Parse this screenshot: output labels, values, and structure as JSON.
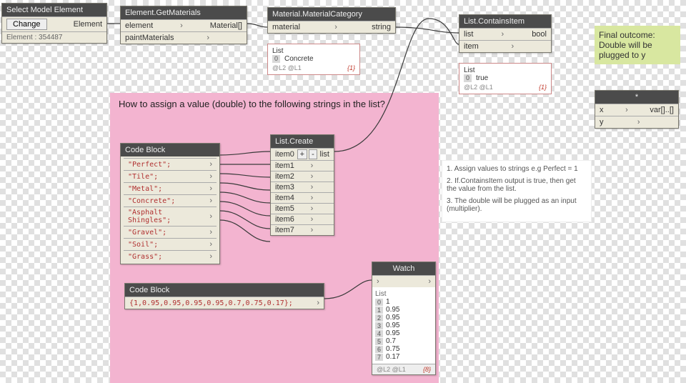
{
  "nodes": {
    "selectModel": {
      "title": "Select Model Element",
      "button": "Change",
      "outPort": "Element",
      "footer": "Element : 354487"
    },
    "getMaterials": {
      "title": "Element.GetMaterials",
      "in1": "element",
      "in2": "paintMaterials",
      "out": "Material[]"
    },
    "matCategory": {
      "title": "Material.MaterialCategory",
      "in": "material",
      "out": "string"
    },
    "containsItem": {
      "title": "List.ContainsItem",
      "in1": "list",
      "in2": "item",
      "out": "bool"
    },
    "multiply": {
      "title": "*",
      "in1": "x",
      "in2": "y",
      "out": "var[]..[]"
    },
    "codeBlock1": {
      "title": "Code Block",
      "lines": [
        "\"Perfect\";",
        "\"Tile\";",
        "\"Metal\";",
        "\"Concrete\";",
        "\"Asphalt Shingles\";",
        "\"Gravel\";",
        "\"Soil\";",
        "\"Grass\";"
      ]
    },
    "listCreate": {
      "title": "List.Create",
      "items": [
        "item0",
        "item1",
        "item2",
        "item3",
        "item4",
        "item5",
        "item6",
        "item7"
      ],
      "out": "list"
    },
    "codeBlock2": {
      "title": "Code Block",
      "code": "{1,0.95,0.95,0.95,0.95,0.7,0.75,0.17};"
    },
    "watch": {
      "title": "Watch",
      "listLabel": "List",
      "values": [
        "1",
        "0.95",
        "0.95",
        "0.95",
        "0.95",
        "0.7",
        "0.75",
        "0.17"
      ],
      "footerL": "@L2 @L1",
      "footerR": "{8}"
    }
  },
  "previews": {
    "matCat": {
      "label": "List",
      "idx": "0",
      "val": "Concrete",
      "footL": "@L2 @L1",
      "footR": "{1}"
    },
    "contains": {
      "label": "List",
      "idx": "0",
      "val": "true",
      "footL": "@L2 @L1",
      "footR": "{1}"
    }
  },
  "annotations": {
    "pinkQuestion": "How to assign a value (double) to the following strings in the list?",
    "greenNote": "Final outcome: Double will be plugged to y",
    "steps": {
      "s1": "1. Assign values to strings e.g Perfect = 1",
      "s2": "2. If.ContainsItem output is true, then get the value from the list.",
      "s3": "3. The double will be plugged as an input (multiplier)."
    }
  },
  "chart_data": {
    "type": "table",
    "title": "String→double mapping",
    "categories": [
      "Perfect",
      "Tile",
      "Metal",
      "Concrete",
      "Asphalt Shingles",
      "Gravel",
      "Soil",
      "Grass"
    ],
    "values": [
      1,
      0.95,
      0.95,
      0.95,
      0.95,
      0.7,
      0.75,
      0.17
    ]
  }
}
